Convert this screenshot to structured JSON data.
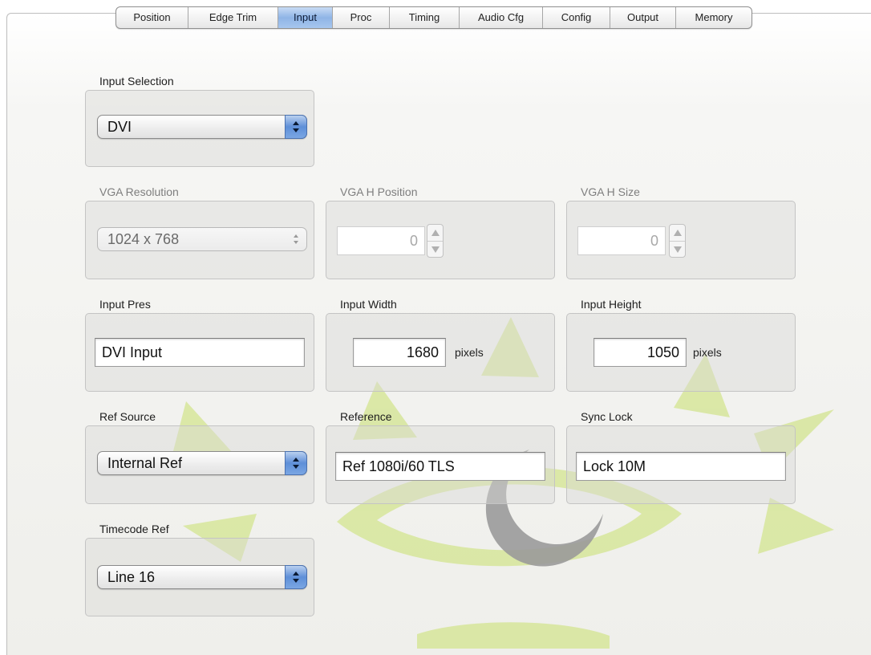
{
  "tabs": [
    {
      "label": "Position",
      "active": false
    },
    {
      "label": "Edge Trim",
      "active": false
    },
    {
      "label": "Input",
      "active": true
    },
    {
      "label": "Proc",
      "active": false
    },
    {
      "label": "Timing",
      "active": false
    },
    {
      "label": "Audio Cfg",
      "active": false
    },
    {
      "label": "Config",
      "active": false
    },
    {
      "label": "Output",
      "active": false
    },
    {
      "label": "Memory",
      "active": false
    }
  ],
  "input_selection": {
    "label": "Input Selection",
    "value": "DVI"
  },
  "vga_resolution": {
    "label": "VGA Resolution",
    "value": "1024 x 768",
    "enabled": false
  },
  "vga_h_position": {
    "label": "VGA H Position",
    "value": "0",
    "enabled": false
  },
  "vga_h_size": {
    "label": "VGA H Size",
    "value": "0",
    "enabled": false
  },
  "input_pres": {
    "label": "Input Pres",
    "value": "DVI Input"
  },
  "input_width": {
    "label": "Input Width",
    "value": "1680",
    "unit": "pixels"
  },
  "input_height": {
    "label": "Input Height",
    "value": "1050",
    "unit": "pixels"
  },
  "ref_source": {
    "label": "Ref Source",
    "value": "Internal Ref"
  },
  "reference": {
    "label": "Reference",
    "value": "Ref 1080i/60 TLS"
  },
  "sync_lock": {
    "label": "Sync Lock",
    "value": "Lock 10M"
  },
  "timecode_ref": {
    "label": "Timecode Ref",
    "value": "Line 16"
  },
  "colors": {
    "accent": "#6f9be0",
    "watermark_green": "#cfe18a",
    "watermark_gray": "#9a9a9a"
  }
}
